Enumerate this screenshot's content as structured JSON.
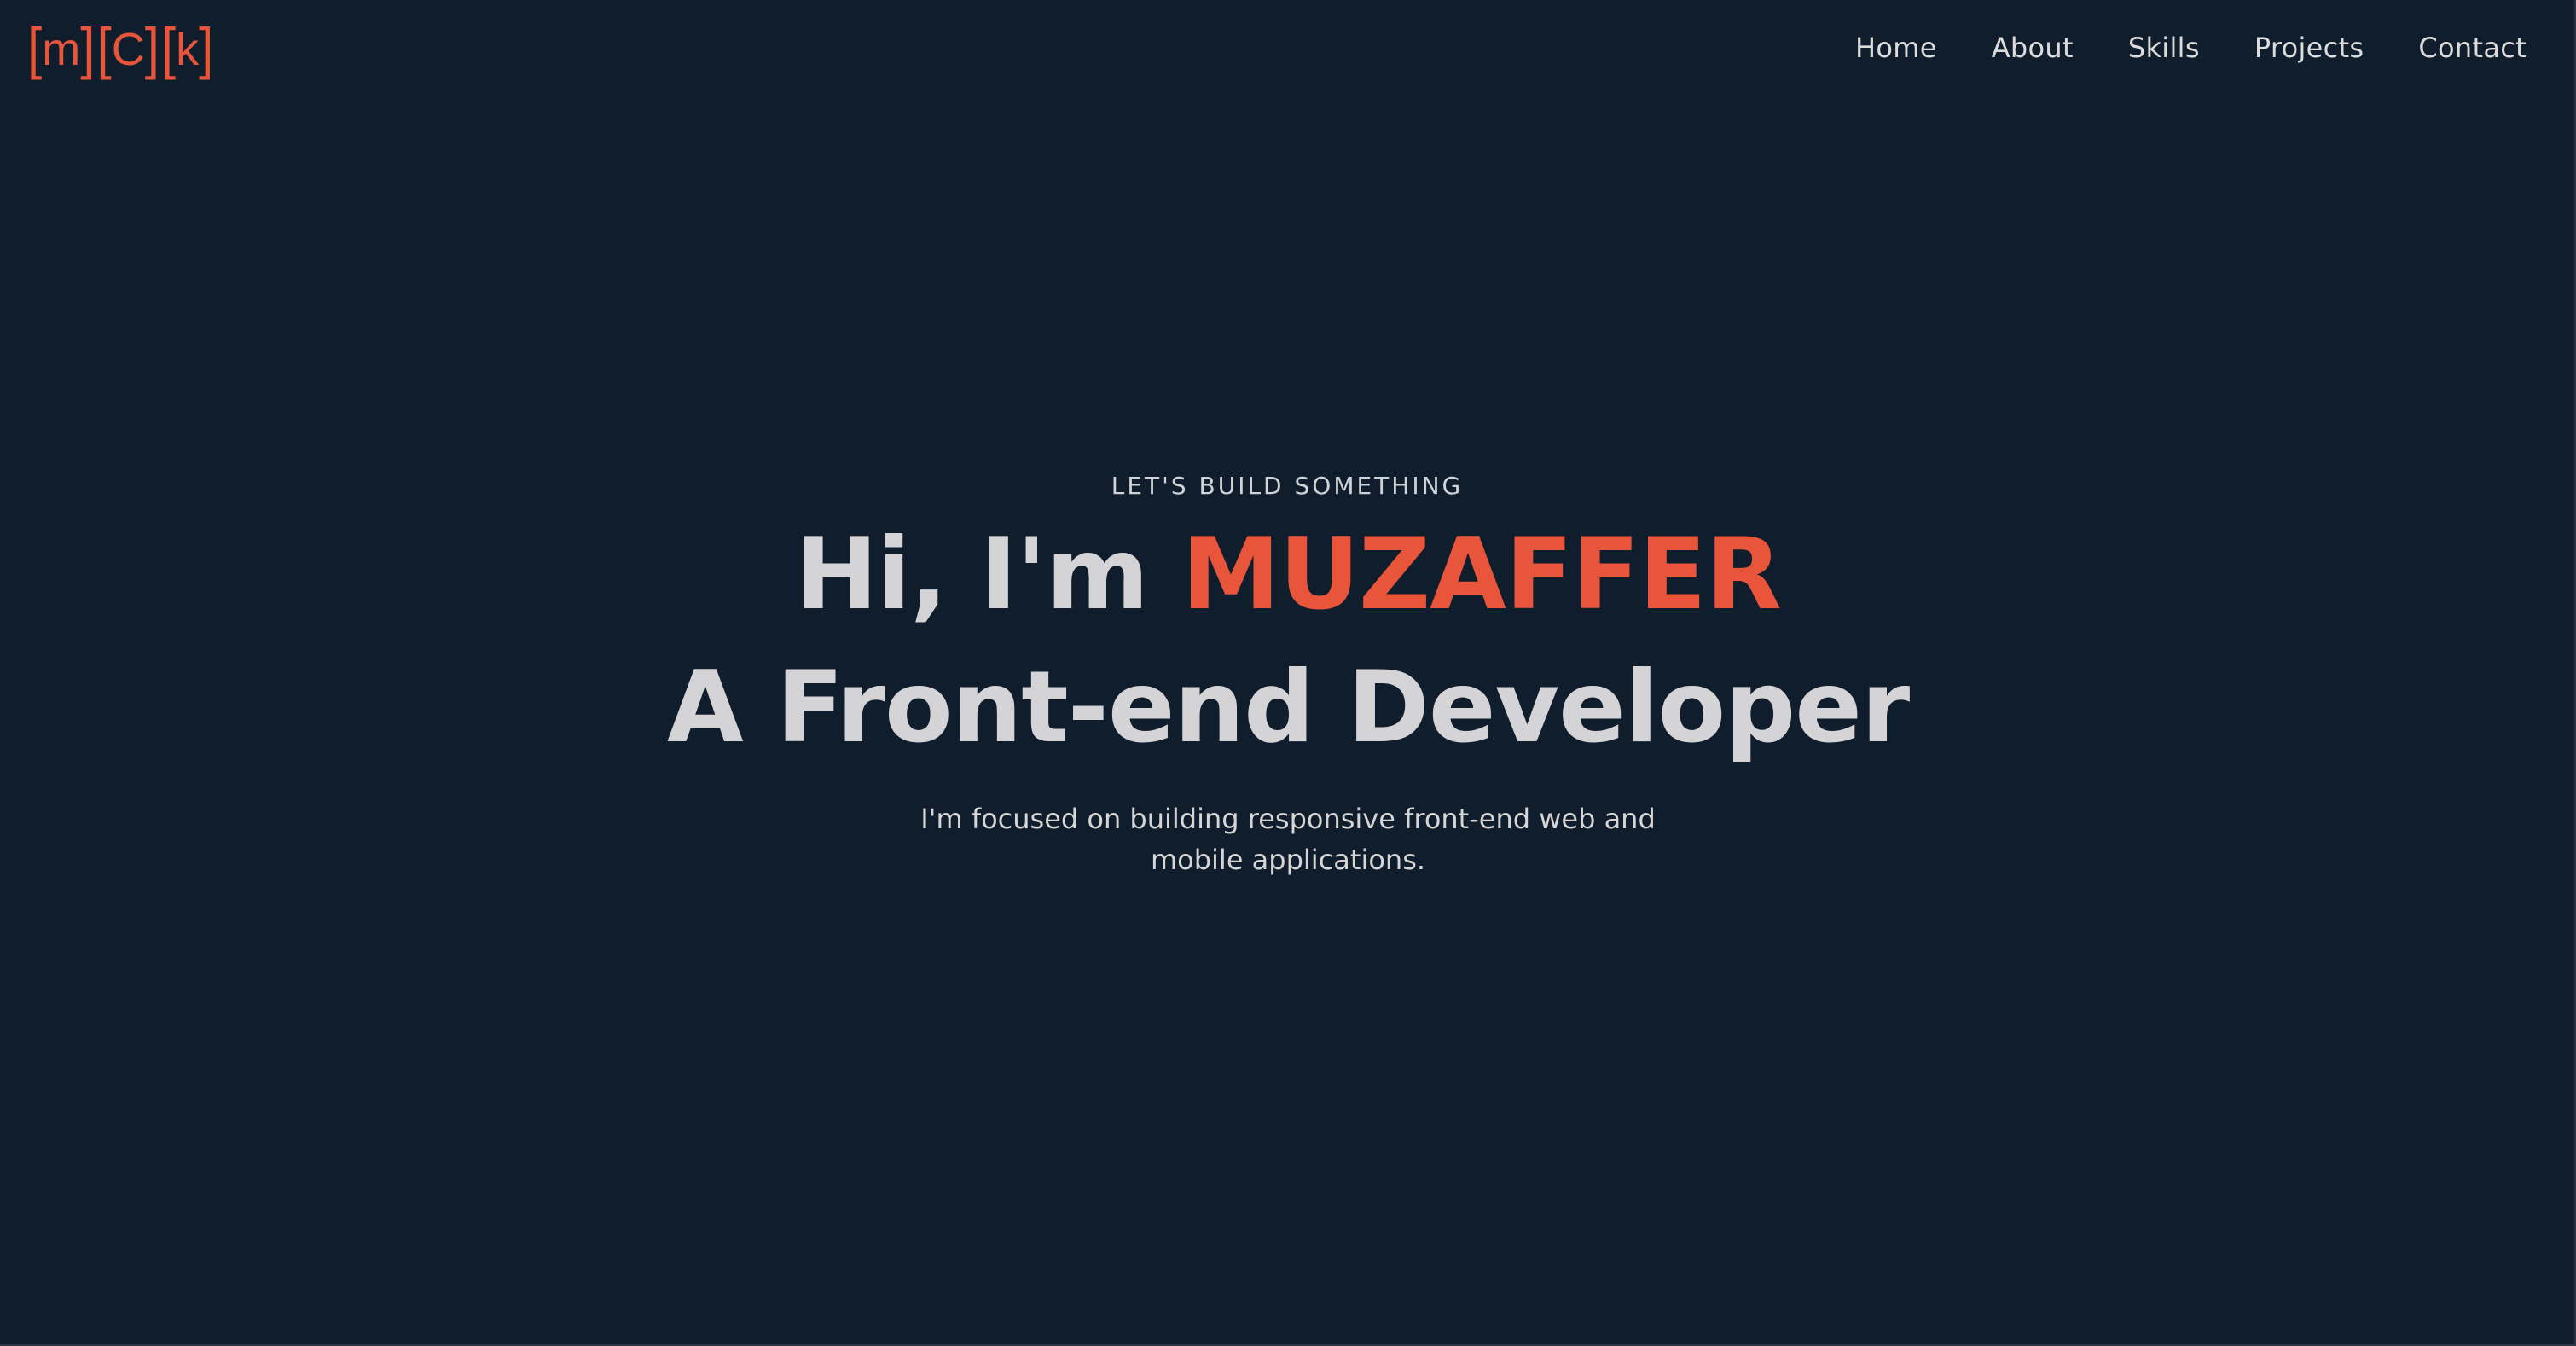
{
  "brand": {
    "logo_chars": [
      "m",
      "C",
      "k"
    ],
    "accent_color": "#e8553b",
    "background_color": "#101d2c"
  },
  "nav": {
    "items": [
      {
        "label": "Home"
      },
      {
        "label": "About"
      },
      {
        "label": "Skills"
      },
      {
        "label": "Projects"
      },
      {
        "label": "Contact"
      }
    ]
  },
  "hero": {
    "eyebrow": "LET'S BUILD SOMETHING",
    "greeting": "Hi, I'm ",
    "name": "MUZAFFER",
    "role": "A Front-end Developer",
    "tagline": "I'm focused on building responsive front-end web and mobile applications."
  }
}
